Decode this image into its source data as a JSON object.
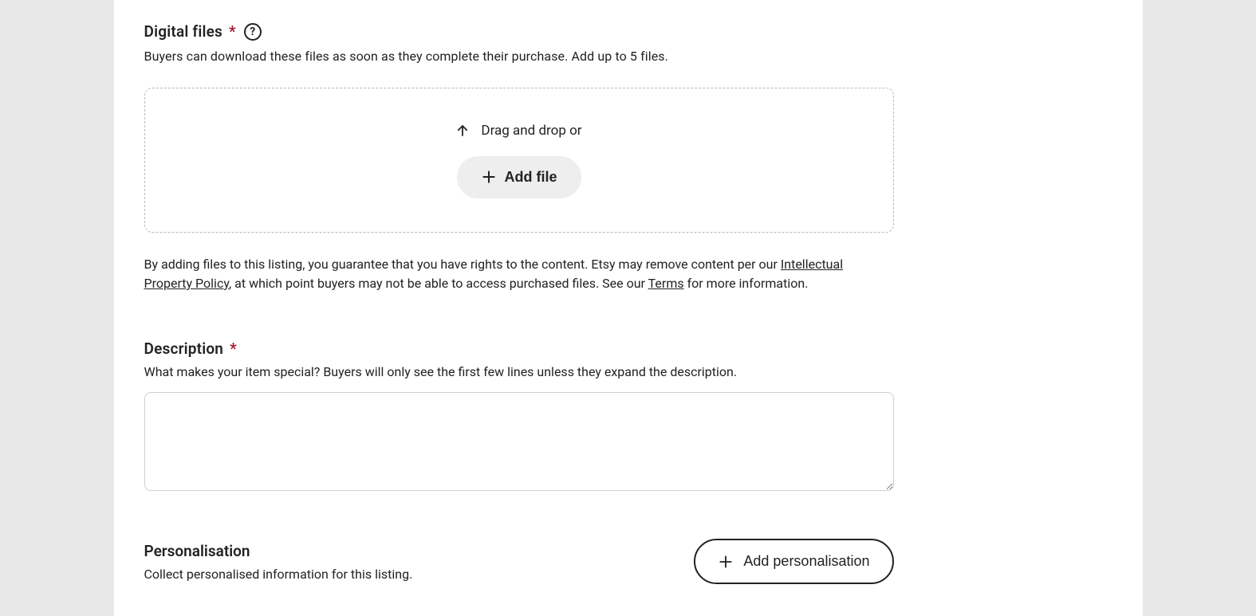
{
  "digital": {
    "title": "Digital files",
    "required_mark": "*",
    "subtitle": "Buyers can download these files as soon as they complete their purchase. Add up to 5 files.",
    "dropzone": {
      "drag_text": "Drag and drop or",
      "add_file_label": "Add file"
    },
    "legal": {
      "part1": "By adding files to this listing, you guarantee that you have rights to the content. Etsy may remove content per our ",
      "ip_link": "Intellectual Property Policy",
      "part2": ", at which point buyers may not be able to access purchased files. See our ",
      "terms_link": "Terms",
      "part3": " for more information."
    }
  },
  "description": {
    "title": "Description",
    "required_mark": "*",
    "subtitle": "What makes your item special? Buyers will only see the first few lines unless they expand the description.",
    "value": ""
  },
  "personalisation": {
    "title": "Personalisation",
    "subtitle": "Collect personalised information for this listing.",
    "button_label": "Add personalisation"
  }
}
